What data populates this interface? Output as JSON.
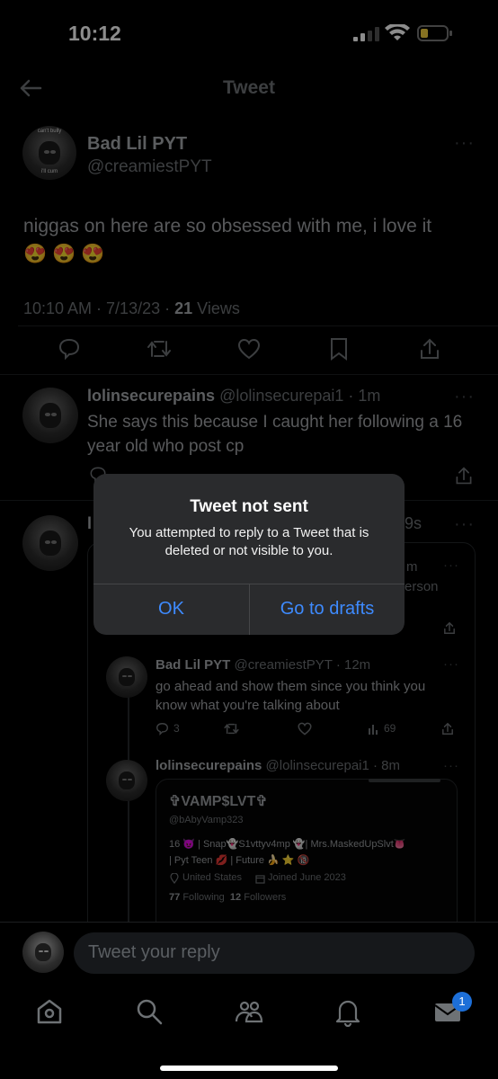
{
  "status_bar": {
    "time": "10:12"
  },
  "header": {
    "title": "Tweet"
  },
  "main_tweet": {
    "name": "Bad Lil PYT",
    "handle": "@creamiestPYT",
    "text": "niggas on here are so obsessed with me, i love it",
    "emojis": "😍 😍 😍",
    "timestamp": "10:10 AM · 7/13/23 · ",
    "views_count": "21",
    "views_label": " Views",
    "avatar_text_top": "can't bully",
    "avatar_text_bottom": "i'll cum"
  },
  "reply1": {
    "name": "lolinsecurepains",
    "handle": "@lolinsecurepai1 · 1m",
    "text": "She says this because I caught her following a 16 year old who post cp"
  },
  "reply2": {
    "name_initial": "l",
    "time_partial": "9s",
    "quoted_partial_1": "m",
    "quoted_partial_2": "erson"
  },
  "nested_reply1": {
    "name": "Bad Lil PYT",
    "handle": "@creamiestPYT · 12m",
    "text": "go ahead and show them since you think you know what you're talking about",
    "replies": "3",
    "views": "69"
  },
  "nested_reply2": {
    "name": "lolinsecurepains",
    "handle": "@lolinsecurepai1 · 8m"
  },
  "profile_card": {
    "name": "✞VAMP$LVT✞",
    "handle": "@bAbyVamp323",
    "bio_line1": "16 😈 | Snap👻S1vttyv4mp 👻| Mrs.MaskedUpSlvt👅",
    "bio_line2": "| Pyt Teen 💋 | Future 🍌 ⭐ 🔞",
    "location": "United States",
    "joined": "Joined June 2023",
    "following_count": "77",
    "following_label": "Following",
    "followers_count": "12",
    "followers_label": "Followers"
  },
  "alert": {
    "title": "Tweet not sent",
    "message": "You attempted to reply to a Tweet that is deleted or not visible to you.",
    "ok_label": "OK",
    "drafts_label": "Go to drafts"
  },
  "reply_bar": {
    "placeholder": "Tweet your reply"
  },
  "bottom_nav": {
    "messages_badge": "1"
  },
  "colors": {
    "accent": "#3e8bff",
    "background": "#000000",
    "alert_bg": "#2a2b2d",
    "badge": "#1d6fd8"
  }
}
